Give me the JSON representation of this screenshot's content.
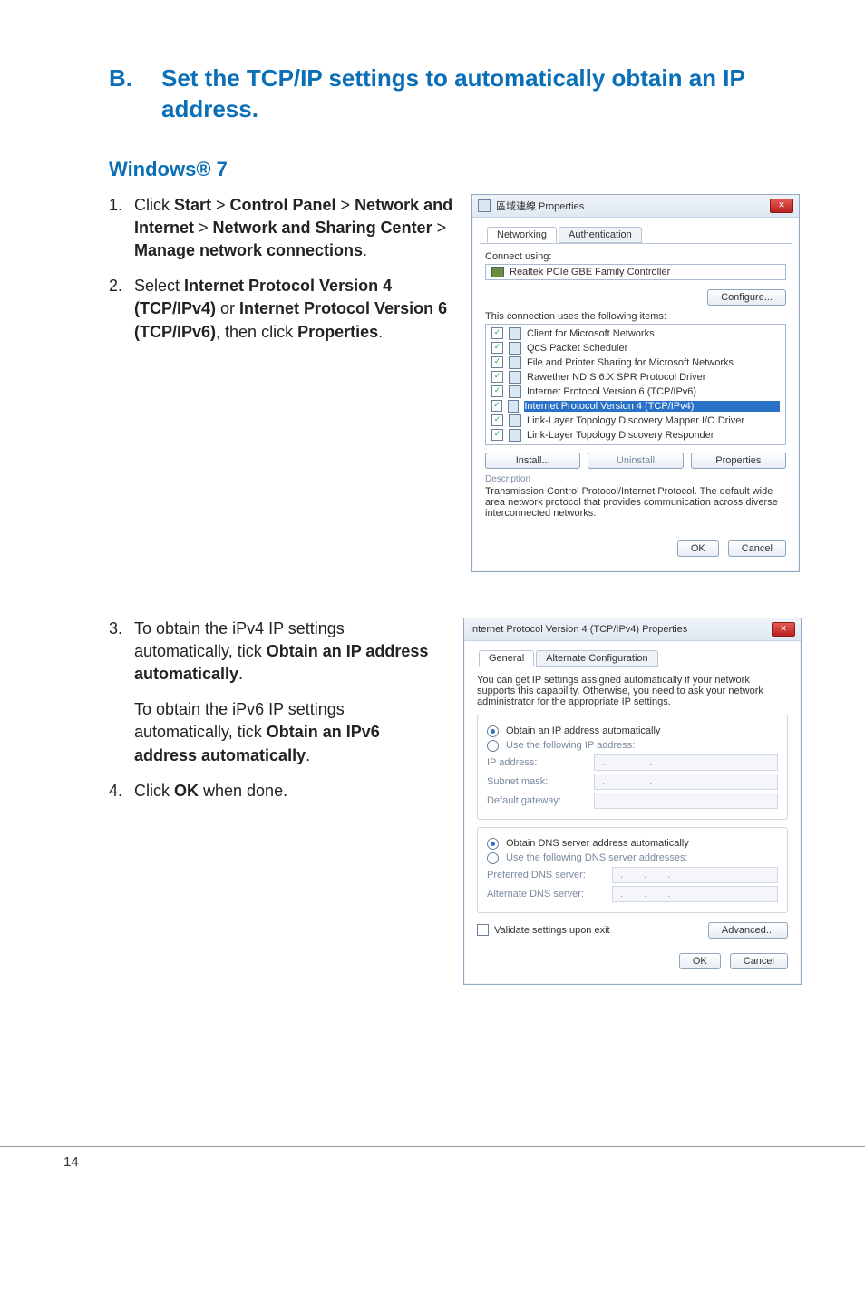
{
  "section": {
    "letter": "B.",
    "title": "Set the TCP/IP settings to automatically obtain an IP address."
  },
  "subsection": "Windows® 7",
  "steps_a": [
    {
      "num": "1.",
      "parts": [
        "Click ",
        "Start",
        " > ",
        "Control Panel",
        " > ",
        "Network and Internet",
        " > ",
        "Network and Sharing Center",
        " > ",
        "Manage network connections",
        "."
      ]
    },
    {
      "num": "2.",
      "parts": [
        "Select ",
        "Internet Protocol Version 4 (TCP/IPv4)",
        " or ",
        "Internet Protocol Version 6 (TCP/IPv6)",
        ", then click ",
        "Properties",
        "."
      ]
    }
  ],
  "steps_b": [
    {
      "num": "3.",
      "main_parts": [
        "To obtain the iPv4 IP settings automatically, tick ",
        "Obtain an IP address automatically",
        "."
      ],
      "sub_parts": [
        "To obtain the iPv6 IP settings automatically, tick ",
        "Obtain an IPv6 address automatically",
        "."
      ]
    },
    {
      "num": "4.",
      "parts": [
        "Click ",
        "OK",
        " when done."
      ]
    }
  ],
  "dlg1": {
    "title": "區域連線 Properties",
    "tab1": "Networking",
    "tab2": "Authentication",
    "connect_using": "Connect using:",
    "adapter": "Realtek PCIe GBE Family Controller",
    "configure": "Configure...",
    "uses_items": "This connection uses the following items:",
    "items": [
      "Client for Microsoft Networks",
      "QoS Packet Scheduler",
      "File and Printer Sharing for Microsoft Networks",
      "Rawether NDIS 6.X SPR Protocol Driver",
      "Internet Protocol Version 6 (TCP/IPv6)",
      "Internet Protocol Version 4 (TCP/IPv4)",
      "Link-Layer Topology Discovery Mapper I/O Driver",
      "Link-Layer Topology Discovery Responder"
    ],
    "install": "Install...",
    "uninstall": "Uninstall",
    "properties": "Properties",
    "desc_label": "Description",
    "desc_text": "Transmission Control Protocol/Internet Protocol. The default wide area network protocol that provides communication across diverse interconnected networks.",
    "ok": "OK",
    "cancel": "Cancel"
  },
  "dlg2": {
    "title": "Internet Protocol Version 4 (TCP/IPv4) Properties",
    "tab1": "General",
    "tab2": "Alternate Configuration",
    "intro": "You can get IP settings assigned automatically if your network supports this capability. Otherwise, you need to ask your network administrator for the appropriate IP settings.",
    "r1": "Obtain an IP address automatically",
    "r2": "Use the following IP address:",
    "ip": "IP address:",
    "mask": "Subnet mask:",
    "gw": "Default gateway:",
    "r3": "Obtain DNS server address automatically",
    "r4": "Use the following DNS server addresses:",
    "pdns": "Preferred DNS server:",
    "adns": "Alternate DNS server:",
    "validate": "Validate settings upon exit",
    "advanced": "Advanced...",
    "ok": "OK",
    "cancel": "Cancel"
  },
  "page_number": "14"
}
